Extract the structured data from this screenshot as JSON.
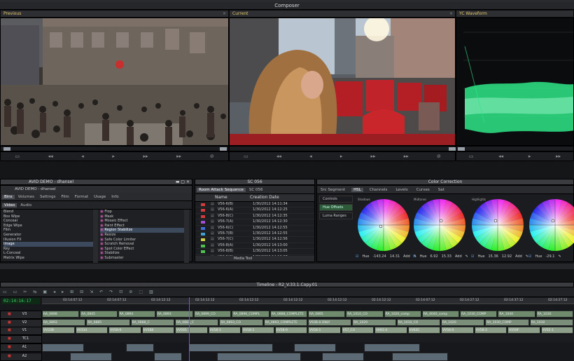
{
  "window": {
    "title": "Composer"
  },
  "viewers": {
    "previous": {
      "label": "Previous"
    },
    "current": {
      "label": "Current"
    },
    "waveform": {
      "label": "YC Waveform"
    }
  },
  "bin": {
    "title": "AVID DEMO - dhansel",
    "subtitle": "AVID DEMO - dhansel",
    "tabs": [
      "Bins",
      "Volumes",
      "Settings",
      "Film",
      "Format",
      "Usage",
      "Info"
    ],
    "subtabs": [
      "Video",
      "Audio"
    ],
    "categories": [
      "Blend",
      "Box Wipe",
      "Conceal",
      "Edge Wipe",
      "Film",
      "Generator",
      "Illusion FX",
      "Image",
      "Key",
      "L-Conceal",
      "Matrix Wipe"
    ],
    "effects": [
      "Flop",
      "Mask",
      "Mosaic Effect",
      "Paint Effect",
      "Region Stabilize",
      "Resize",
      "Safe Color Limiter",
      "Scratch Removal",
      "Spot Color Effect",
      "Stabilize",
      "Submaster"
    ]
  },
  "sequence_bin": {
    "tabs": [
      "Room Attack Sequence",
      "SC 056"
    ],
    "title": "SC 056",
    "col_name": "Name",
    "col_date": "Creation Date",
    "footer_label": "Media Tool",
    "rows": [
      {
        "name": "V56-6(B)",
        "date": "1/30/2012 14:11:34",
        "color": "#d33c3c"
      },
      {
        "name": "V56-6(A)",
        "date": "1/30/2012 14:12:25",
        "color": "#d33c3c"
      },
      {
        "name": "V56-8(C)",
        "date": "1/30/2012 14:12:35",
        "color": "#d33c3c"
      },
      {
        "name": "V56-7(A)",
        "date": "1/30/2012 14:12:30",
        "color": "#a050d0"
      },
      {
        "name": "V56-6(C)",
        "date": "1/30/2012 14:12:55",
        "color": "#4070d8"
      },
      {
        "name": "V56-7(B)",
        "date": "1/30/2012 14:12:55",
        "color": "#40a0d0"
      },
      {
        "name": "V56-7(C)",
        "date": "1/30/2012 14:12:56",
        "color": "#d0d040"
      },
      {
        "name": "V56-8(A)",
        "date": "1/30/2012 14:13:00",
        "color": "#50c050"
      },
      {
        "name": "V56-8(B)",
        "date": "1/30/2012 14:13:05",
        "color": "#50c050"
      },
      {
        "name": "V56-5(C)",
        "date": "1/30/2012 14:13:07",
        "color": "#d07030"
      }
    ]
  },
  "color_correction": {
    "title": "Color Correction",
    "top_tabs": [
      "Src Segment",
      "HSL",
      "Channels",
      "Levels",
      "Curves",
      "Sat"
    ],
    "side_items": [
      "Controls",
      "Hue Offsets",
      "Luma Ranges"
    ],
    "wheels": [
      {
        "label": "Shadows",
        "hue_label": "Hue",
        "hue": "-143.24",
        "sat": "14.31",
        "add_label": "Add"
      },
      {
        "label": "Midtones",
        "hue_label": "Hue",
        "hue": "6.92",
        "sat": "15.33",
        "add_label": "Add"
      },
      {
        "label": "Highlights",
        "hue_label": "Hue",
        "hue": "15.36",
        "sat": "12.92",
        "add_label": "Add"
      },
      {
        "label": "",
        "hue_label": "Hue",
        "hue": "-29.1",
        "sat": "",
        "add_label": ""
      }
    ]
  },
  "timeline": {
    "title": "Timeline - R2_V.33.1.Copy.01",
    "timecode": "02:14:16:17",
    "ruler": [
      "02:14:07:12",
      "02:14:07:12",
      "02:14:12:12",
      "02:14:12:12",
      "02:14:12:12",
      "02:14:12:12",
      "02:14:12:12",
      "02:14:12:12",
      "02:14:07:12",
      "02:14:27:12",
      "02:14:37:12",
      "02:14:27:12"
    ],
    "tracks": [
      "V3",
      "V2",
      "V1",
      "TC1",
      "A1",
      "A2"
    ],
    "v3_clips": [
      "RA_0898",
      "RA_0845",
      "RA_0894",
      "RA_0893",
      "RA_0899_CO",
      "RA_0896_COMPL",
      "RA_0888_COMPLETE",
      "RA_0895",
      "RA_1010_CO",
      "RA_1020_comp",
      "RA_4040_comp",
      "RA_1030_COMP",
      "RA_1040",
      "RA_1030"
    ],
    "v2_clips": [
      "RA_0893",
      "RA_0885",
      "RA_0888_C",
      "RA_0883_C",
      "RA_0893_CO",
      "RA_0893_COMPLETE",
      "V93B-0.ONLY",
      "RA_1020",
      "RA_1010_CO",
      "RA_1020",
      "RA_1030_COMP",
      "RA_1030"
    ],
    "v1_clips": [
      "VV33B",
      "VV334",
      "VV58-0",
      "VV588",
      "VV591",
      "VV58-1",
      "VV58-1",
      "VV58-9",
      "VV58-1",
      "V57_CU",
      "VA93-4",
      "VV63C",
      "VV58-0",
      "VV5B-2",
      "VV59F",
      "VV5E-1"
    ]
  },
  "colors": {
    "accent": "#e4c86a",
    "waveform": "#2fe88a",
    "timecode": "#3fd06a",
    "playhead": "#7a4cff"
  }
}
